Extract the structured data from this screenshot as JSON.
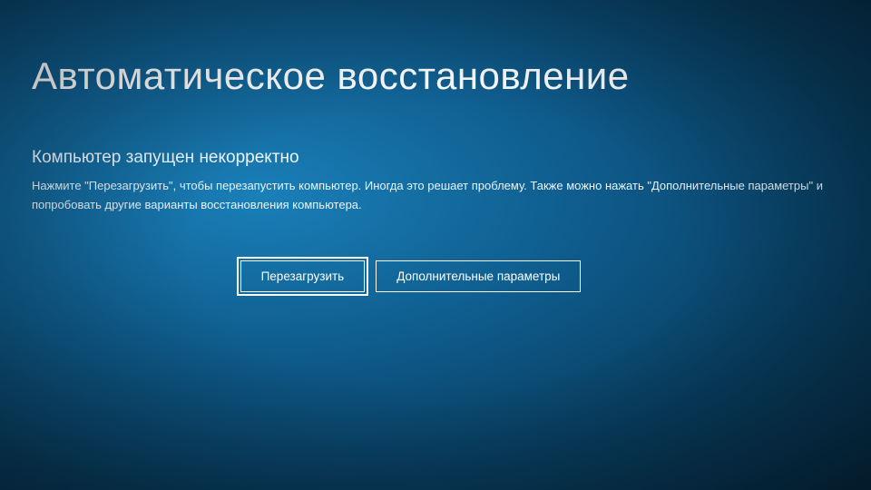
{
  "screen": {
    "title": "Автоматическое восстановление",
    "subtitle": "Компьютер запущен некорректно",
    "description": "Нажмите \"Перезагрузить\", чтобы перезапустить компьютер. Иногда это решает проблему. Также можно нажать \"Дополнительные параметры\" и попробовать другие варианты восстановления компьютера."
  },
  "buttons": {
    "restart": "Перезагрузить",
    "advanced": "Дополнительные параметры"
  }
}
